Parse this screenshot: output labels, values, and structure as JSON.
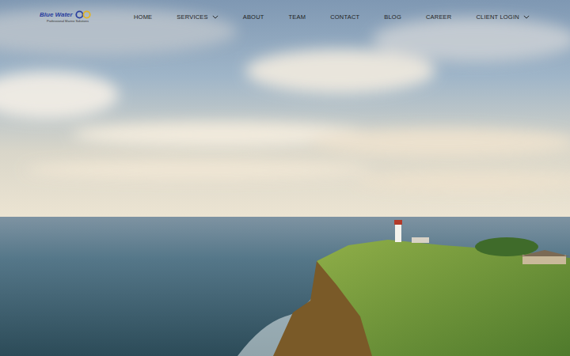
{
  "logo": {
    "name": "Blue Water",
    "tagline": "Professional Marine Solutions"
  },
  "nav": {
    "items": [
      {
        "label": "HOME",
        "dropdown": false
      },
      {
        "label": "SERVICES",
        "dropdown": true
      },
      {
        "label": "ABOUT",
        "dropdown": false
      },
      {
        "label": "TEAM",
        "dropdown": false
      },
      {
        "label": "CONTACT",
        "dropdown": false
      },
      {
        "label": "BLOG",
        "dropdown": false
      },
      {
        "label": "CAREER",
        "dropdown": false
      },
      {
        "label": "CLIENT LOGIN",
        "dropdown": true
      }
    ]
  }
}
